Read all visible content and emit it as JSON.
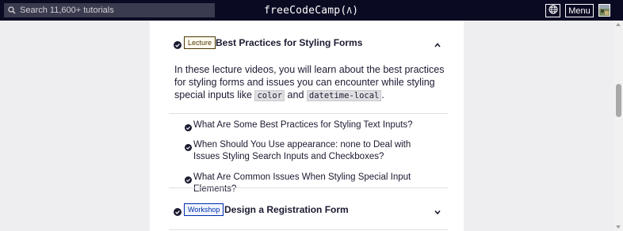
{
  "navbar": {
    "search_placeholder": "Search 11,600+ tutorials",
    "logo_text": "freeCodeCamp(",
    "logo_flame": "Ʌ",
    "logo_close": ")",
    "menu_label": "Menu"
  },
  "sections": [
    {
      "badge": "Lecture",
      "title": "Best Practices for Styling Forms",
      "expanded": true,
      "description_parts": {
        "text1": "In these lecture videos, you will learn about the best practices for styling forms and issues you can encounter while styling special inputs like ",
        "code1": "color",
        "text2": " and ",
        "code2": "datetime-local",
        "text3": "."
      },
      "lessons": [
        "What Are Some Best Practices for Styling Text Inputs?",
        "When Should You Use appearance: none to Deal with Issues Styling Search Inputs and Checkboxes?",
        "What Are Common Issues When Styling Special Input Elements?"
      ]
    },
    {
      "badge": "Workshop",
      "title": "Design a Registration Form",
      "expanded": false
    }
  ],
  "colors": {
    "navbar_bg": "#0a0a23",
    "lecture_badge": "#4d3800",
    "workshop_badge": "#002ead",
    "text": "#1b1b32"
  }
}
